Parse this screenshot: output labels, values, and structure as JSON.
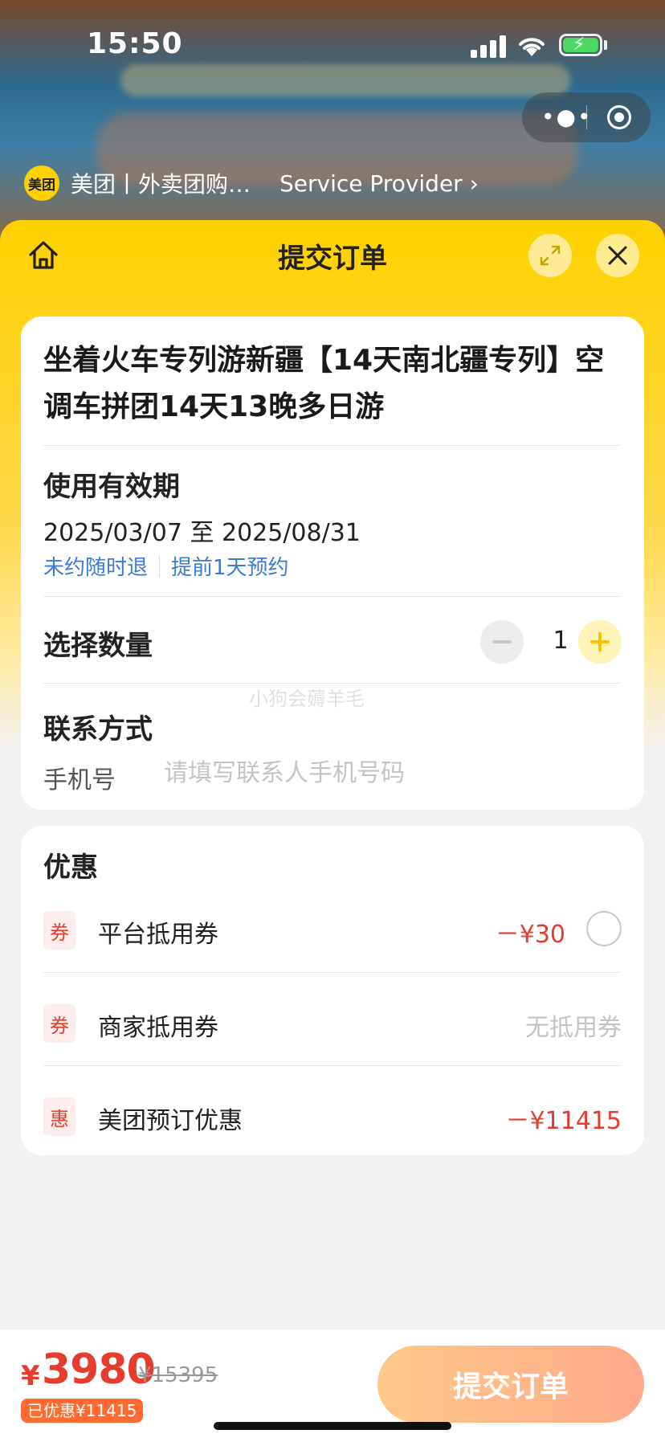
{
  "status_bar": {
    "time": "15:50"
  },
  "mini_app": {
    "logo_text": "美团",
    "name": "美团丨外卖团购…",
    "provider_link": "Service Provider ›"
  },
  "sheet": {
    "title": "提交订单"
  },
  "product": {
    "title": "坐着火车专列游新疆【14天南北疆专列】空调车拼团14天13晚多日游"
  },
  "validity": {
    "label": "使用有效期",
    "date_range": "2025/03/07 至 2025/08/31",
    "tags": [
      "未约随时退",
      "提前1天预约"
    ]
  },
  "quantity": {
    "label": "选择数量",
    "value": "1"
  },
  "watermark": "小狗会薅羊毛",
  "contact": {
    "label": "联系方式",
    "phone_label": "手机号",
    "phone_placeholder": "请填写联系人手机号码",
    "phone_value": ""
  },
  "discounts": {
    "title": "优惠",
    "items": [
      {
        "badge": "券",
        "label": "平台抵用券",
        "value": "－¥30",
        "selected": false
      },
      {
        "badge": "券",
        "label": "商家抵用券",
        "value": "无抵用券"
      },
      {
        "badge": "惠",
        "label": "美团预订优惠",
        "value": "－¥11415"
      }
    ]
  },
  "checkout": {
    "currency": "¥",
    "price": "3980",
    "original_price": "¥15395",
    "saved_text": "已优惠¥11415",
    "submit_label": "提交订单"
  },
  "colors": {
    "brand_yellow": "#ffd100",
    "price_red": "#e63c2e",
    "link_blue": "#3a7bd5",
    "submit_gradient": [
      "#ffc98a",
      "#ffa88a"
    ]
  }
}
